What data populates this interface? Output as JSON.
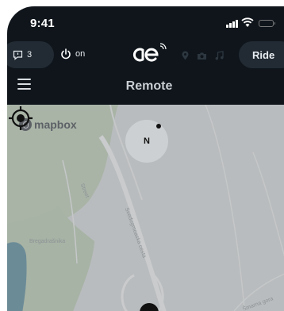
{
  "status_bar": {
    "time": "9:41"
  },
  "controls": {
    "notification_count": "3",
    "power_label": "on",
    "ride_label": "Ride"
  },
  "header": {
    "title": "Remote"
  },
  "map": {
    "attribution": "mapbox",
    "compass_label": "N",
    "street_labels": [
      "Street",
      "Svedugmoaska cesta",
      "Bregadrašnika",
      "Šmarna gora"
    ]
  },
  "colors": {
    "background": "#0f151b",
    "pill": "#222b33",
    "map": "#b9bcbe",
    "water": "#6b8b97",
    "park": "#a7b3a5"
  }
}
